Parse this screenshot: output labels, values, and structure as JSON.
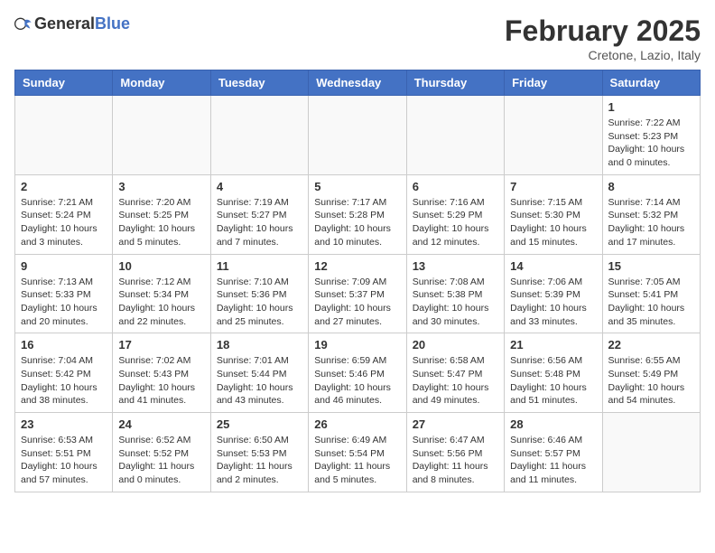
{
  "header": {
    "logo_general": "General",
    "logo_blue": "Blue",
    "month_title": "February 2025",
    "location": "Cretone, Lazio, Italy"
  },
  "weekdays": [
    "Sunday",
    "Monday",
    "Tuesday",
    "Wednesday",
    "Thursday",
    "Friday",
    "Saturday"
  ],
  "weeks": [
    [
      {
        "day": "",
        "info": ""
      },
      {
        "day": "",
        "info": ""
      },
      {
        "day": "",
        "info": ""
      },
      {
        "day": "",
        "info": ""
      },
      {
        "day": "",
        "info": ""
      },
      {
        "day": "",
        "info": ""
      },
      {
        "day": "1",
        "info": "Sunrise: 7:22 AM\nSunset: 5:23 PM\nDaylight: 10 hours\nand 0 minutes."
      }
    ],
    [
      {
        "day": "2",
        "info": "Sunrise: 7:21 AM\nSunset: 5:24 PM\nDaylight: 10 hours\nand 3 minutes."
      },
      {
        "day": "3",
        "info": "Sunrise: 7:20 AM\nSunset: 5:25 PM\nDaylight: 10 hours\nand 5 minutes."
      },
      {
        "day": "4",
        "info": "Sunrise: 7:19 AM\nSunset: 5:27 PM\nDaylight: 10 hours\nand 7 minutes."
      },
      {
        "day": "5",
        "info": "Sunrise: 7:17 AM\nSunset: 5:28 PM\nDaylight: 10 hours\nand 10 minutes."
      },
      {
        "day": "6",
        "info": "Sunrise: 7:16 AM\nSunset: 5:29 PM\nDaylight: 10 hours\nand 12 minutes."
      },
      {
        "day": "7",
        "info": "Sunrise: 7:15 AM\nSunset: 5:30 PM\nDaylight: 10 hours\nand 15 minutes."
      },
      {
        "day": "8",
        "info": "Sunrise: 7:14 AM\nSunset: 5:32 PM\nDaylight: 10 hours\nand 17 minutes."
      }
    ],
    [
      {
        "day": "9",
        "info": "Sunrise: 7:13 AM\nSunset: 5:33 PM\nDaylight: 10 hours\nand 20 minutes."
      },
      {
        "day": "10",
        "info": "Sunrise: 7:12 AM\nSunset: 5:34 PM\nDaylight: 10 hours\nand 22 minutes."
      },
      {
        "day": "11",
        "info": "Sunrise: 7:10 AM\nSunset: 5:36 PM\nDaylight: 10 hours\nand 25 minutes."
      },
      {
        "day": "12",
        "info": "Sunrise: 7:09 AM\nSunset: 5:37 PM\nDaylight: 10 hours\nand 27 minutes."
      },
      {
        "day": "13",
        "info": "Sunrise: 7:08 AM\nSunset: 5:38 PM\nDaylight: 10 hours\nand 30 minutes."
      },
      {
        "day": "14",
        "info": "Sunrise: 7:06 AM\nSunset: 5:39 PM\nDaylight: 10 hours\nand 33 minutes."
      },
      {
        "day": "15",
        "info": "Sunrise: 7:05 AM\nSunset: 5:41 PM\nDaylight: 10 hours\nand 35 minutes."
      }
    ],
    [
      {
        "day": "16",
        "info": "Sunrise: 7:04 AM\nSunset: 5:42 PM\nDaylight: 10 hours\nand 38 minutes."
      },
      {
        "day": "17",
        "info": "Sunrise: 7:02 AM\nSunset: 5:43 PM\nDaylight: 10 hours\nand 41 minutes."
      },
      {
        "day": "18",
        "info": "Sunrise: 7:01 AM\nSunset: 5:44 PM\nDaylight: 10 hours\nand 43 minutes."
      },
      {
        "day": "19",
        "info": "Sunrise: 6:59 AM\nSunset: 5:46 PM\nDaylight: 10 hours\nand 46 minutes."
      },
      {
        "day": "20",
        "info": "Sunrise: 6:58 AM\nSunset: 5:47 PM\nDaylight: 10 hours\nand 49 minutes."
      },
      {
        "day": "21",
        "info": "Sunrise: 6:56 AM\nSunset: 5:48 PM\nDaylight: 10 hours\nand 51 minutes."
      },
      {
        "day": "22",
        "info": "Sunrise: 6:55 AM\nSunset: 5:49 PM\nDaylight: 10 hours\nand 54 minutes."
      }
    ],
    [
      {
        "day": "23",
        "info": "Sunrise: 6:53 AM\nSunset: 5:51 PM\nDaylight: 10 hours\nand 57 minutes."
      },
      {
        "day": "24",
        "info": "Sunrise: 6:52 AM\nSunset: 5:52 PM\nDaylight: 11 hours\nand 0 minutes."
      },
      {
        "day": "25",
        "info": "Sunrise: 6:50 AM\nSunset: 5:53 PM\nDaylight: 11 hours\nand 2 minutes."
      },
      {
        "day": "26",
        "info": "Sunrise: 6:49 AM\nSunset: 5:54 PM\nDaylight: 11 hours\nand 5 minutes."
      },
      {
        "day": "27",
        "info": "Sunrise: 6:47 AM\nSunset: 5:56 PM\nDaylight: 11 hours\nand 8 minutes."
      },
      {
        "day": "28",
        "info": "Sunrise: 6:46 AM\nSunset: 5:57 PM\nDaylight: 11 hours\nand 11 minutes."
      },
      {
        "day": "",
        "info": ""
      }
    ]
  ]
}
